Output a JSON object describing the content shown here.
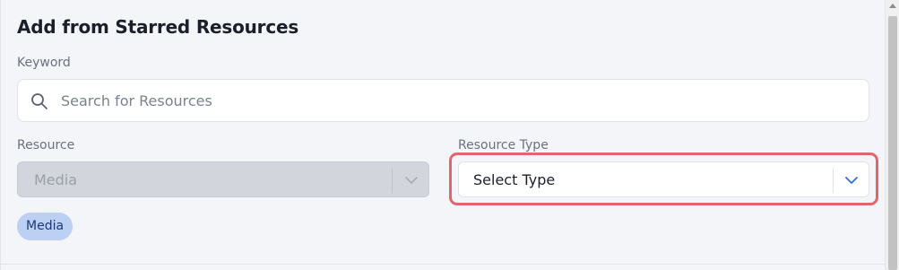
{
  "dialog": {
    "title": "Add from Starred Resources"
  },
  "keyword": {
    "label": "Keyword",
    "placeholder": "Search for Resources",
    "value": ""
  },
  "resource": {
    "label": "Resource",
    "value": "Media",
    "disabled": true
  },
  "resource_type": {
    "label": "Resource Type",
    "value": "Select Type"
  },
  "chips": [
    {
      "label": "Media"
    }
  ],
  "icons": {
    "search": "search-icon",
    "chevron": "chevron-down-icon"
  },
  "colors": {
    "accent": "#2f6fd6",
    "focus_ring": "#e2656b",
    "chip_bg": "#bcd0f4",
    "chip_text": "#1c3a78"
  }
}
